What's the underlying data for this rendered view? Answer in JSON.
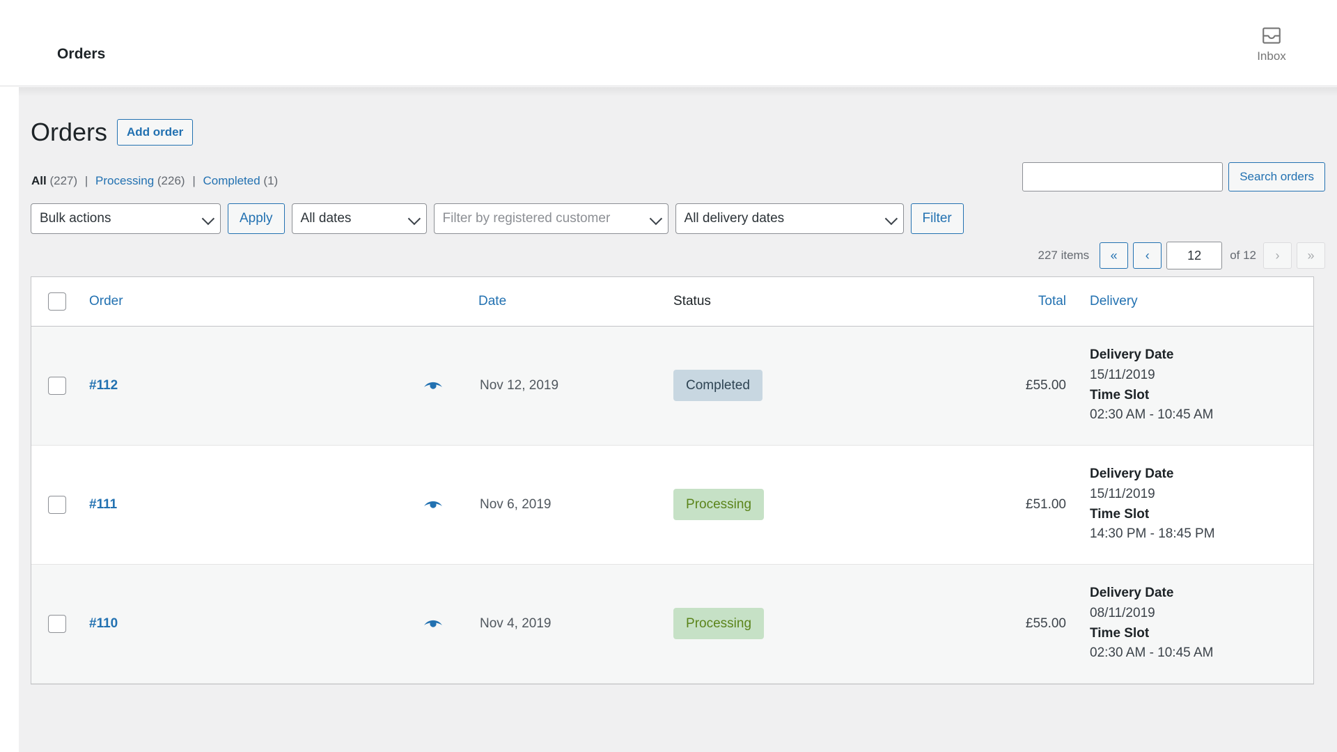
{
  "topbar": {
    "title": "Orders",
    "inbox_label": "Inbox",
    "inbox_icon": "inbox-tray-icon"
  },
  "page": {
    "title": "Orders",
    "add_order_label": "Add order"
  },
  "status_links": [
    {
      "label": "All",
      "count": "(227)",
      "current": true
    },
    {
      "label": "Processing",
      "count": "(226)",
      "current": false
    },
    {
      "label": "Completed",
      "count": "(1)",
      "current": false
    }
  ],
  "separator": "|",
  "search": {
    "value": "",
    "placeholder": "",
    "button_label": "Search orders"
  },
  "filters": {
    "bulk_actions": "Bulk actions",
    "apply_label": "Apply",
    "all_dates": "All dates",
    "customer_placeholder": "Filter by registered customer",
    "all_delivery_dates": "All delivery dates",
    "filter_label": "Filter"
  },
  "pagination": {
    "items_text": "227 items",
    "first_label": "«",
    "prev_label": "‹",
    "current_page": "12",
    "of_text": "of 12",
    "next_label": "›",
    "last_label": "»"
  },
  "table": {
    "columns": {
      "order": "Order",
      "date": "Date",
      "status": "Status",
      "total": "Total",
      "delivery": "Delivery"
    },
    "delivery_labels": {
      "date": "Delivery Date",
      "slot": "Time Slot"
    },
    "rows": [
      {
        "order": "#112",
        "date": "Nov 12, 2019",
        "status": "Completed",
        "status_kind": "completed",
        "total": "£55.00",
        "delivery_date": "15/11/2019",
        "time_slot": "02:30 AM - 10:45 AM"
      },
      {
        "order": "#111",
        "date": "Nov 6, 2019",
        "status": "Processing",
        "status_kind": "processing",
        "total": "£51.00",
        "delivery_date": "15/11/2019",
        "time_slot": "14:30 PM - 18:45 PM"
      },
      {
        "order": "#110",
        "date": "Nov 4, 2019",
        "status": "Processing",
        "status_kind": "processing",
        "total": "£55.00",
        "delivery_date": "08/11/2019",
        "time_slot": "02:30 AM - 10:45 AM"
      }
    ]
  },
  "colors": {
    "link": "#2271b1",
    "page_bg": "#f0f0f1",
    "badge_completed_bg": "#c8d7e1",
    "badge_processing_bg": "#c6e1c6"
  }
}
